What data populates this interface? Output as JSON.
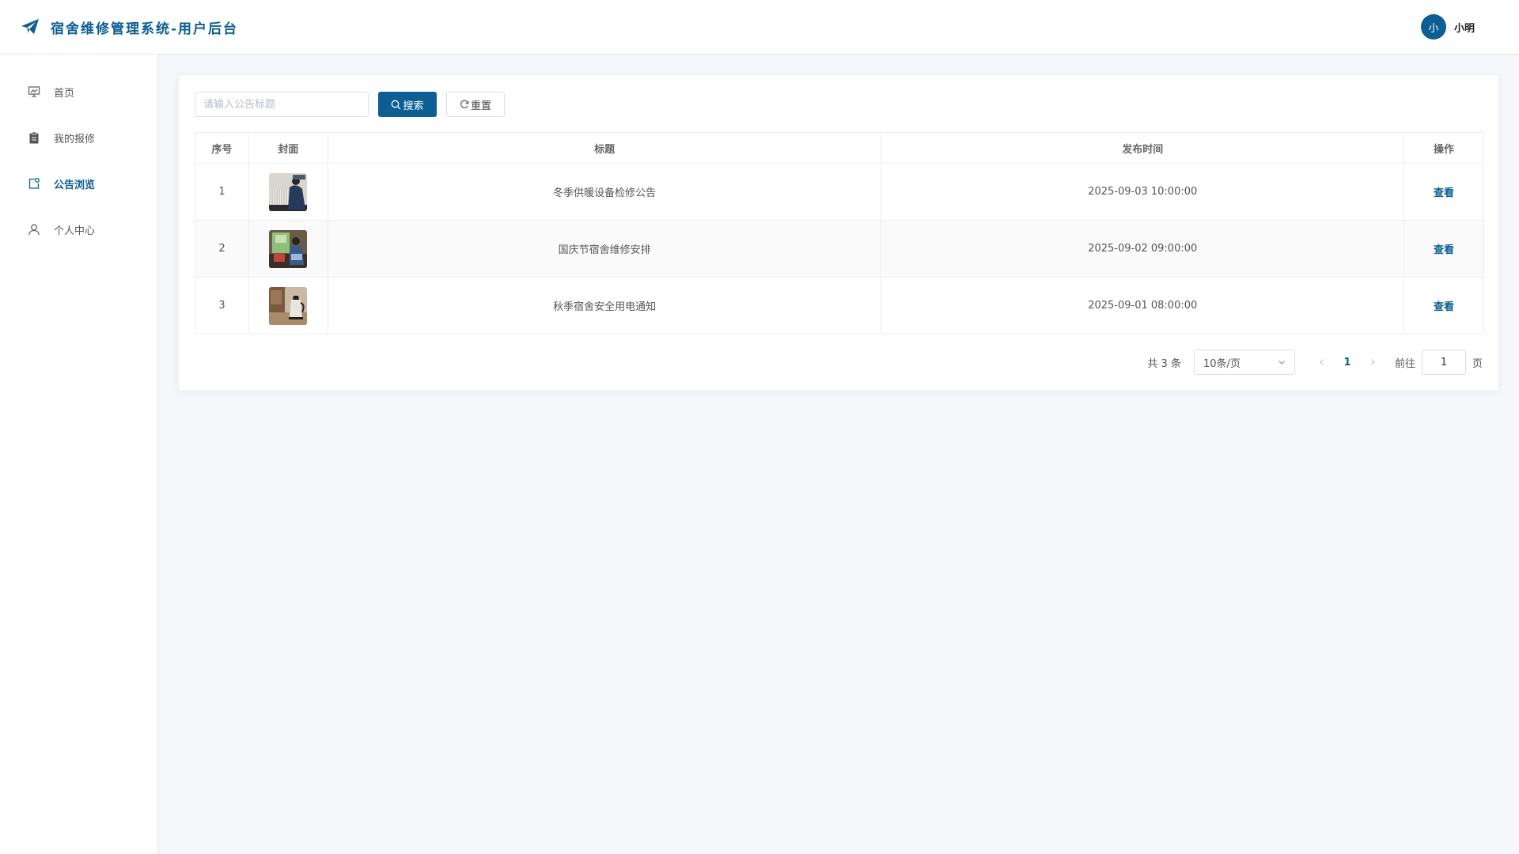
{
  "header": {
    "title": "宿舍维修管理系统-用户后台",
    "logo_icon": "paper-plane-icon",
    "user": {
      "avatar_text": "小",
      "name": "小明"
    }
  },
  "sidebar": {
    "items": [
      {
        "label": "首页",
        "icon": "presentation-icon",
        "active": false
      },
      {
        "label": "我的报修",
        "icon": "clipboard-icon",
        "active": false
      },
      {
        "label": "公告浏览",
        "icon": "notice-icon",
        "active": true
      },
      {
        "label": "个人中心",
        "icon": "user-icon",
        "active": false
      }
    ]
  },
  "search": {
    "placeholder": "请输入公告标题",
    "value": "",
    "search_label": "搜索",
    "reset_label": "重置"
  },
  "table": {
    "columns": [
      "序号",
      "封面",
      "标题",
      "发布时间",
      "操作"
    ],
    "rows": [
      {
        "index": "1",
        "cover": "radiator-repair-photo",
        "title": "冬季供暖设备检修公告",
        "time": "2025-09-03 10:00:00",
        "action": "查看"
      },
      {
        "index": "2",
        "cover": "dorm-room-photo",
        "title": "国庆节宿舍维修安排",
        "time": "2025-09-02 09:00:00",
        "action": "查看"
      },
      {
        "index": "3",
        "cover": "electric-kettle-photo",
        "title": "秋季宿舍安全用电通知",
        "time": "2025-09-01 08:00:00",
        "action": "查看"
      }
    ]
  },
  "pagination": {
    "total_text": "共 3 条",
    "page_size": "10条/页",
    "current_page": "1",
    "goto_label": "前往",
    "goto_value": "1",
    "page_suffix": "页"
  },
  "colors": {
    "accent": "#0c5e93",
    "background": "#f5f7fa"
  }
}
